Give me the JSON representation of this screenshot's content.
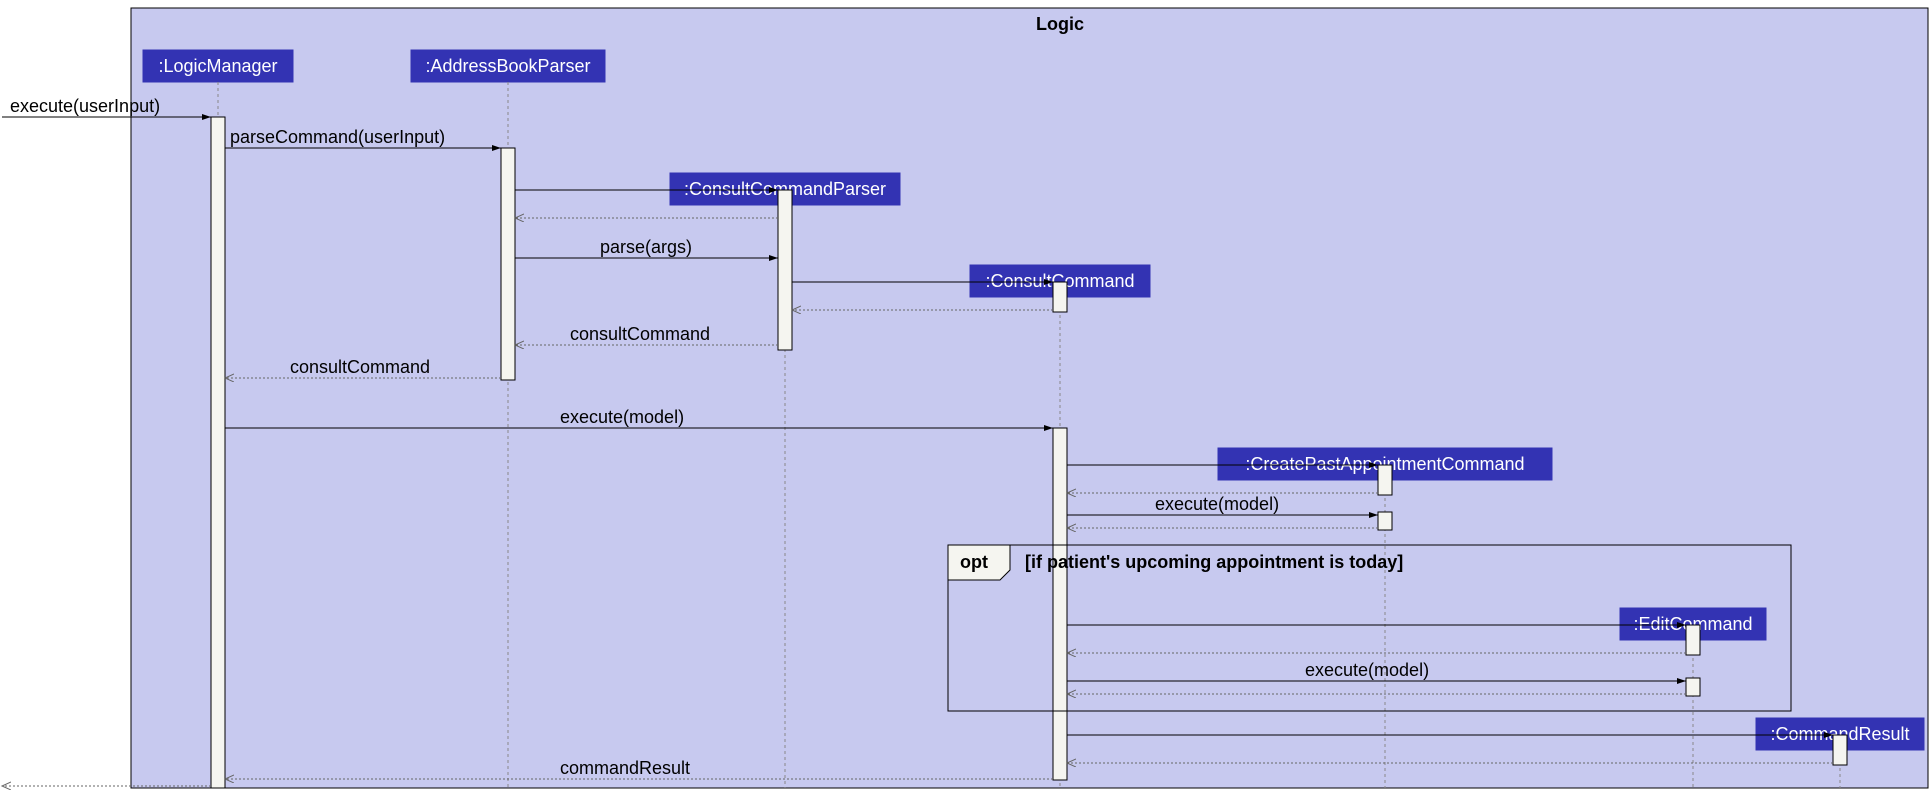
{
  "frame": {
    "title": "Logic"
  },
  "lifelines": {
    "logicManager": ":LogicManager",
    "addressBookParser": ":AddressBookParser",
    "consultCommandParser": ":ConsultCommandParser",
    "consultCommand": ":ConsultCommand",
    "createPastAppointmentCommand": ":CreatePastAppointmentCommand",
    "editCommand": ":EditCommand",
    "commandResult": ":CommandResult"
  },
  "messages": {
    "executeUserInput": "execute(userInput)",
    "parseCommandUserInput": "parseCommand(userInput)",
    "parseArgs": "parse(args)",
    "consultCommandReturn1": "consultCommand",
    "consultCommandReturn2": "consultCommand",
    "executeModel1": "execute(model)",
    "executeModel2": "execute(model)",
    "executeModel3": "execute(model)",
    "commandResultReturn": "commandResult"
  },
  "fragments": {
    "optLabel": "opt",
    "optGuard": "[if patient's upcoming appointment is today]"
  }
}
